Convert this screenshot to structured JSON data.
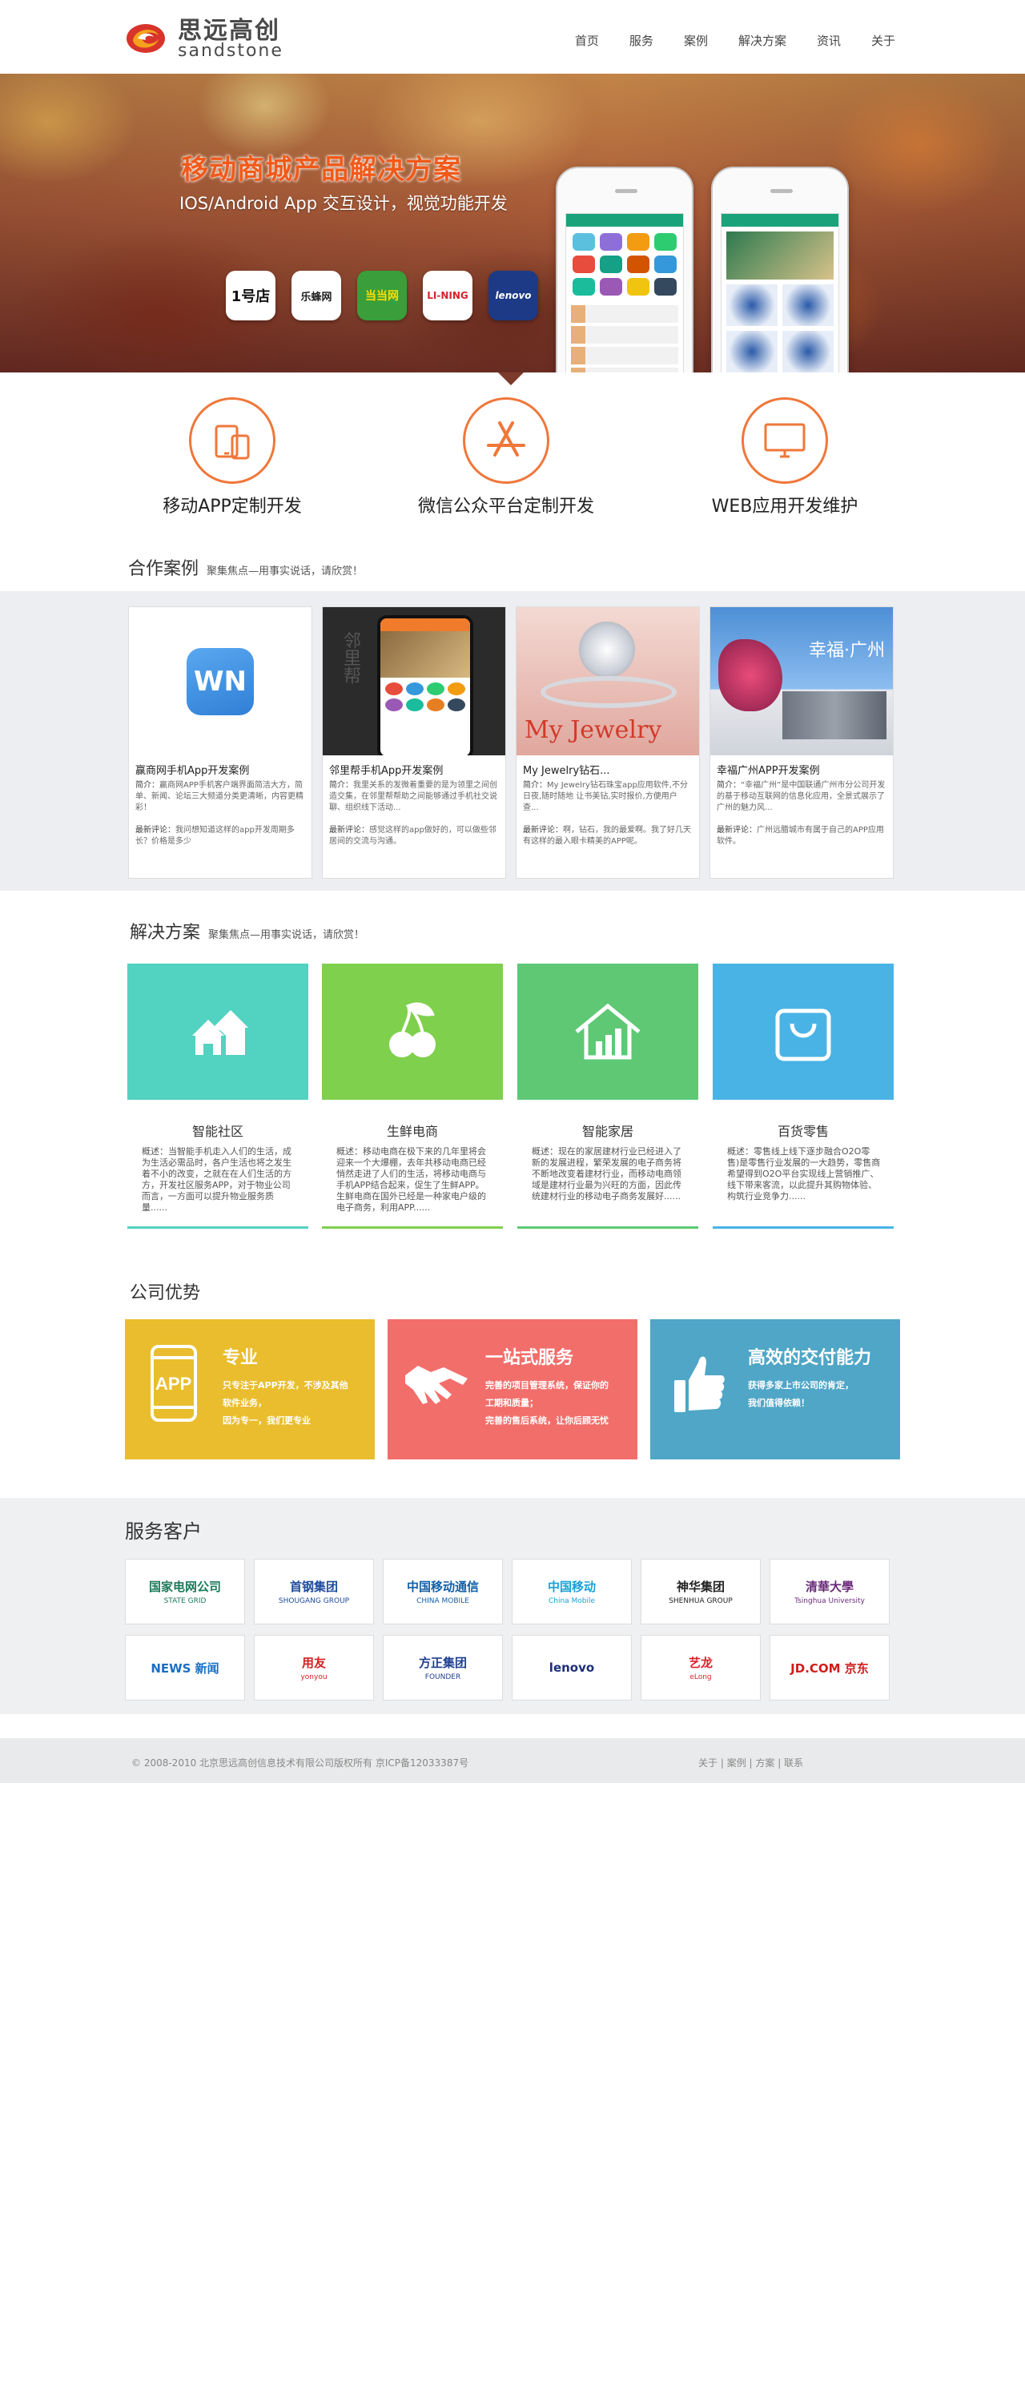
{
  "header": {
    "logo_cn": "思远高创",
    "logo_en": "sandstone",
    "nav": [
      "首页",
      "服务",
      "案例",
      "解决方案",
      "资讯",
      "关于"
    ]
  },
  "banner": {
    "title": "移动商城产品解决方案",
    "subtitle": "IOS/Android App 交互设计，视觉功能开发",
    "brands": [
      "1号店",
      "乐蜂网",
      "当当网",
      "LI-NING",
      "lenovo"
    ]
  },
  "services": [
    {
      "label": "移动APP定制开发",
      "icon": "mobile-tablet-icon"
    },
    {
      "label": "微信公众平台定制开发",
      "icon": "appstore-icon"
    },
    {
      "label": "WEB应用开发维护",
      "icon": "monitor-icon"
    }
  ],
  "cases": {
    "title": "合作案例",
    "subtitle": "聚集焦点—用事实说话，请欣赏！",
    "items": [
      {
        "title": "赢商网手机App开发案例",
        "desc_label": "简介：",
        "desc": "赢商网APP手机客户端界面简洁大方，简单、新闻、论坛三大频道分类更清晰，内容更精彩！",
        "review_label": "最新评论：",
        "review": "我问想知道这样的app开发周期多长？价格是多少",
        "image_text": "WN"
      },
      {
        "title": "邻里帮手机App开发案例",
        "desc_label": "简介：",
        "desc": "我里关系的发微着重要的是为领里之间创造交集，在邻里帮帮助之间能够通过手机社交说聊、组织线下活动...",
        "review_label": "最新评论：",
        "review": "感觉这样的app做好的，可以做些邻居间的交流与沟通。",
        "image_text": "邻里帮"
      },
      {
        "title": "My Jewelry钻石...",
        "desc_label": "简介：",
        "desc": "My Jewelry钻石珠宝app应用软件,不分日夜,随时随地 让书美钻,实时报价,方便用户查...",
        "review_label": "最新评论：",
        "review": "啊，钻石，我的最爱啊。我了好几天有这样的最入眼卡精美的APP呢。",
        "image_text": "My Jewelry"
      },
      {
        "title": "幸福广州APP开发案例",
        "desc_label": "简介：",
        "desc": "“幸福广州”是中国联通广州市分公司开发的基于移动互联网的信息化应用，全景式展示了广州的魅力风...",
        "review_label": "最新评论：",
        "review": "广州远腊城市有属于自己的APP应用软件。",
        "image_text": "幸福·广州"
      }
    ]
  },
  "solutions": {
    "title": "解决方案",
    "subtitle": "聚集焦点—用事实说话，请欣赏！",
    "items": [
      {
        "name": "智能社区",
        "color": "#52d2c0",
        "icon": "community-houses-icon",
        "desc": "概述：当智能手机走入人们的生活，成为生活必需品时，各户生活也将之发生着不小的改变，之就在在人们生活的方方，开发社区服务APP，对于物业公司而言，一方面可以提升物业服务质量......"
      },
      {
        "name": "生鲜电商",
        "color": "#7fd04d",
        "icon": "cherry-icon",
        "desc": "概述：移动电商在极下来的几年里将会迎来一个大爆棚，去年共移动电商已经悄然走进了人们的生活，将移动电商与手机APP结合起来，促生了生鲜APP。生鲜电商在国外已经是一种家电户级的电子商务，利用APP......"
      },
      {
        "name": "智能家居",
        "color": "#5ec874",
        "icon": "smart-home-icon",
        "desc": "概述：现在的家居建材行业已经进入了新的发展进程，繁荣发展的电子商务将不断地改变着建材行业，而移动电商领域是建材行业最为兴旺的方面，因此传统建材行业的移动电子商务发展好......"
      },
      {
        "name": "百货零售",
        "color": "#4ab3e6",
        "icon": "shopping-bag-icon",
        "desc": "概述：零售线上线下逐步融合O2O零售)是零售行业发展的一大趋势，零售商希望得到O2O平台实现线上营销推广、线下带来客流，以此提升其购物体验、构筑行业竞争力......"
      }
    ]
  },
  "advantages": {
    "title": "公司优势",
    "items": [
      {
        "heading": "专业",
        "color": "#e9bd2d",
        "icon": "app-phone-icon",
        "lines": [
          "只专注于APP开发，不涉及其他",
          "软件业务，",
          "因为专一，我们更专业"
        ]
      },
      {
        "heading": "一站式服务",
        "color": "#f26e6b",
        "icon": "handshake-icon",
        "lines": [
          "完善的项目管理系统，保证你的",
          "工期和质量；",
          "完善的售后系统，让你后顾无忧"
        ]
      },
      {
        "heading": "高效的交付能力",
        "color": "#4fa6c7",
        "icon": "thumbs-up-icon",
        "lines": [
          "获得多家上市公司的肯定，",
          "我们值得依赖！"
        ]
      }
    ]
  },
  "clients": {
    "title": "服务客户",
    "items": [
      {
        "name": "国家电网公司",
        "sub": "STATE GRID",
        "color": "#1b7a5a"
      },
      {
        "name": "首钢集团",
        "sub": "SHOUGANG GROUP",
        "color": "#1d4aa0"
      },
      {
        "name": "中国移动通信",
        "sub": "CHINA MOBILE",
        "color": "#1160a8"
      },
      {
        "name": "中国移动",
        "sub": "China Mobile",
        "color": "#1aa0d8"
      },
      {
        "name": "神华集团",
        "sub": "SHENHUA GROUP",
        "color": "#222"
      },
      {
        "name": "清華大學",
        "sub": "Tsinghua University",
        "color": "#6a2a7a"
      },
      {
        "name": "NEWS 新闻",
        "sub": "",
        "color": "#1a6fc4"
      },
      {
        "name": "用友",
        "sub": "yonyou",
        "color": "#d22020"
      },
      {
        "name": "方正集团",
        "sub": "FOUNDER",
        "color": "#1f3f8f"
      },
      {
        "name": "lenovo",
        "sub": "",
        "color": "#1c2f7a"
      },
      {
        "name": "艺龙",
        "sub": "eLong",
        "color": "#d8232a"
      },
      {
        "name": "JD.COM 京东",
        "sub": "",
        "color": "#d21c1c"
      }
    ]
  },
  "footer": {
    "copyright": "© 2008-2010 北京思远高创信息技术有限公司版权所有 京ICP备12033387号",
    "links": [
      "关于",
      "案例",
      "方案",
      "联系"
    ]
  }
}
